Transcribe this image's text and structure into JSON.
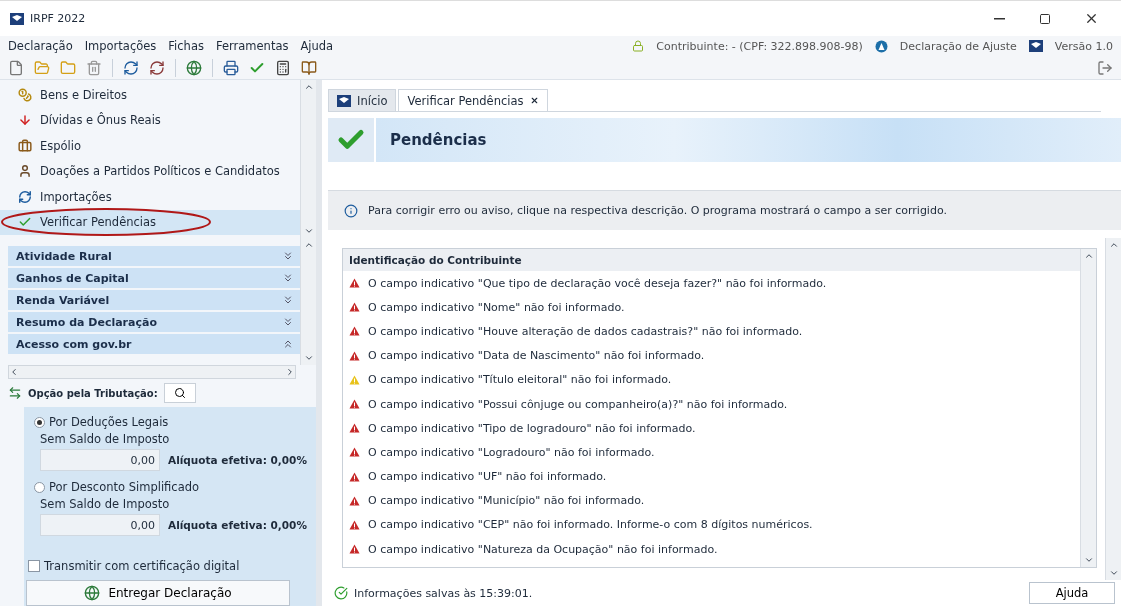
{
  "window": {
    "title": "IRPF 2022"
  },
  "menu": [
    "Declaração",
    "Importações",
    "Fichas",
    "Ferramentas",
    "Ajuda"
  ],
  "status_info": {
    "taxpayer": "Contribuinte:  - (CPF: 322.898.908-98)",
    "declaration": "Declaração de Ajuste",
    "version": "Versão 1.0"
  },
  "sidebar": {
    "items": [
      {
        "label": "Bens e Direitos",
        "selected": false
      },
      {
        "label": "Dívidas e Ônus Reais",
        "selected": false
      },
      {
        "label": "Espólio",
        "selected": false
      },
      {
        "label": "Doações a Partidos Políticos e Candidatos",
        "selected": false
      },
      {
        "label": "Importações",
        "selected": false
      },
      {
        "label": "Verificar Pendências",
        "selected": true
      }
    ],
    "sections": [
      {
        "label": "Atividade Rural",
        "expanded": false
      },
      {
        "label": "Ganhos de Capital",
        "expanded": false
      },
      {
        "label": "Renda Variável",
        "expanded": false
      },
      {
        "label": "Resumo da Declaração",
        "expanded": false
      },
      {
        "label": "Acesso com gov.br",
        "expanded": true
      }
    ]
  },
  "tax_option": {
    "label": "Opção pela Tributação:",
    "options": [
      {
        "label": "Por Deduções Legais",
        "selected": true,
        "status": "Sem Saldo de Imposto",
        "value": "0,00",
        "rate": "Alíquota efetiva: 0,00%"
      },
      {
        "label": "Por Desconto Simplificado",
        "selected": false,
        "status": "Sem Saldo de Imposto",
        "value": "0,00",
        "rate": "Alíquota efetiva: 0,00%"
      }
    ],
    "certificate": {
      "label": "Transmitir com certificação digital",
      "checked": false
    },
    "submit_button": "Entregar Declaração"
  },
  "tabs": [
    {
      "label": "Início",
      "selected": false,
      "closable": false
    },
    {
      "label": "Verificar Pendências",
      "selected": true,
      "closable": true
    }
  ],
  "header": {
    "title": "Pendências"
  },
  "info": "Para corrigir erro ou aviso, clique na respectiva descrição. O programa mostrará o campo a ser corrigido.",
  "issues": {
    "group": "Identificação do Contribuinte",
    "items": [
      {
        "kind": "error",
        "text": "O campo indicativo \"Que tipo de declaração você deseja fazer?\" não foi informado."
      },
      {
        "kind": "error",
        "text": "O campo indicativo \"Nome\" não foi informado."
      },
      {
        "kind": "error",
        "text": "O campo indicativo \"Houve alteração de dados cadastrais?\" não foi informado."
      },
      {
        "kind": "error",
        "text": "O campo indicativo \"Data de Nascimento\" não foi informado."
      },
      {
        "kind": "warning",
        "text": "O campo indicativo \"Título eleitoral\" não foi informado."
      },
      {
        "kind": "error",
        "text": "O campo indicativo \"Possui cônjuge ou companheiro(a)?\" não foi informado."
      },
      {
        "kind": "error",
        "text": "O campo indicativo \"Tipo de logradouro\" não foi informado."
      },
      {
        "kind": "error",
        "text": "O campo indicativo \"Logradouro\" não foi informado."
      },
      {
        "kind": "error",
        "text": "O campo indicativo \"UF\" não foi informado."
      },
      {
        "kind": "error",
        "text": "O campo indicativo \"Município\" não foi informado."
      },
      {
        "kind": "error",
        "text": "O campo indicativo \"CEP\" não foi informado. Informe-o com 8 dígitos numéricos."
      },
      {
        "kind": "error",
        "text": "O campo indicativo \"Natureza da Ocupação\" não foi informado."
      }
    ]
  },
  "status_bar": {
    "text": "Informações salvas às 15:39:01.",
    "help_button": "Ajuda"
  }
}
